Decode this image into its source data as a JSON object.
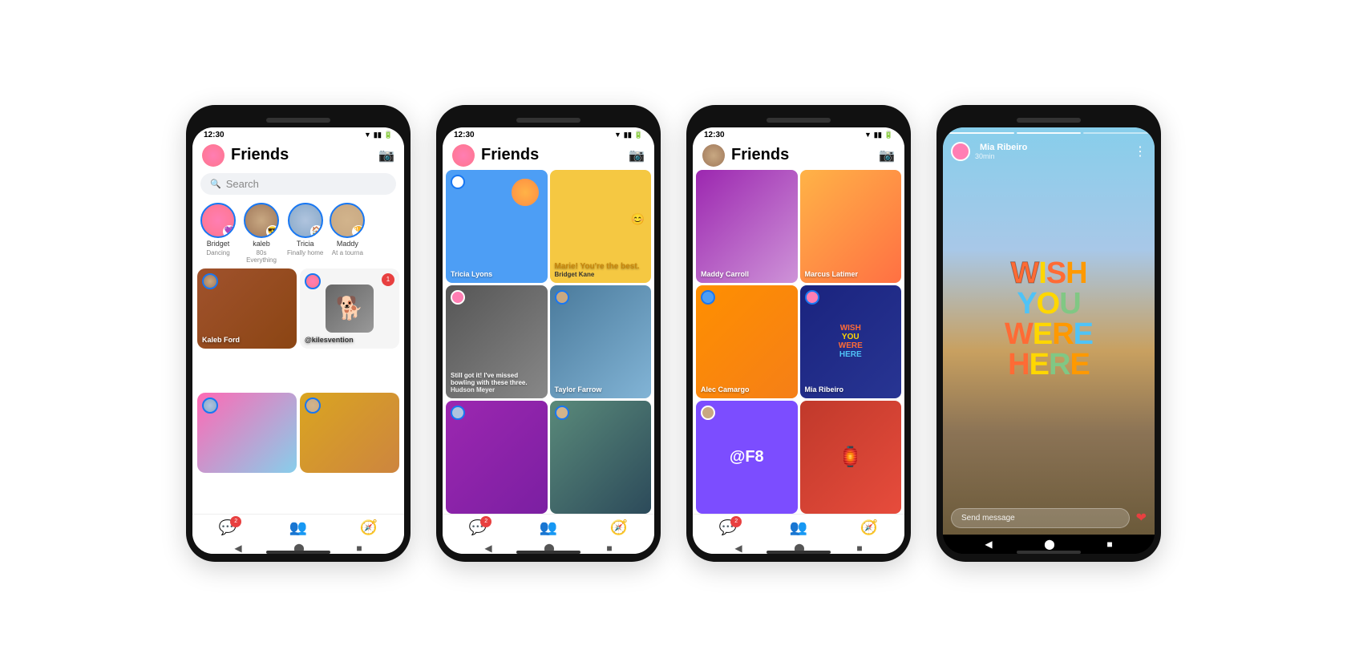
{
  "phones": [
    {
      "id": "phone1",
      "status_time": "12:30",
      "header_title": "Friends",
      "search_placeholder": "Search",
      "stories": [
        {
          "name": "Bridget",
          "sub": "Dancing",
          "av_class": "av1",
          "badge": "💜"
        },
        {
          "name": "kaleb",
          "sub": "80s Everything",
          "av_class": "av2",
          "badge": "😎"
        },
        {
          "name": "Tricia",
          "sub": "Finally home",
          "av_class": "av3",
          "badge": "🏠"
        },
        {
          "name": "Maddy",
          "sub": "At a tourna",
          "av_class": "av4",
          "badge": "🏆"
        }
      ],
      "cards": [
        {
          "label": "Kaleb Ford",
          "bg": "bg-friends",
          "has_av": true,
          "av_class": "av2"
        },
        {
          "label": "@kilesven​tion",
          "bg": "bg-dogs",
          "has_av": true,
          "av_class": "av1",
          "notif": "1"
        },
        {
          "label": "",
          "bg": "bg-pink",
          "has_av": true,
          "av_class": "av3"
        },
        {
          "label": "",
          "bg": "bg-warm",
          "has_av": true,
          "av_class": "av4"
        }
      ],
      "nav_badge": "2"
    },
    {
      "id": "phone2",
      "status_time": "12:30",
      "header_title": "Friends",
      "cards": [
        {
          "title": "Tricia Lyons",
          "sub": "",
          "bg": "bg-blue",
          "has_av": true
        },
        {
          "title": "Marie! You're the best.",
          "sub": "Bridget Kane",
          "bg": "bg-yellow",
          "text_dark": true
        },
        {
          "title": "Still got it! I've missed bowling with these three.",
          "sub": "Hudson Meyer",
          "bg": "bg-bowling"
        },
        {
          "title": "Taylor Farrow",
          "sub": "",
          "bg": "bg-dance",
          "has_av": true
        },
        {
          "title": "",
          "sub": "",
          "bg": "bg-hair",
          "has_av": true
        },
        {
          "title": "",
          "sub": "",
          "bg": "bg-teal-portrait",
          "has_av": true
        }
      ],
      "nav_badge": "2"
    },
    {
      "id": "phone3",
      "status_time": "12:30",
      "header_title": "Friends",
      "cards": [
        {
          "title": "Maddy Carroll",
          "sub": "",
          "bg": "bg-hair"
        },
        {
          "title": "Marcus Latimer",
          "sub": "",
          "bg": "bg-peach"
        },
        {
          "title": "Alec Camargo",
          "sub": "",
          "bg": "bg-autumn",
          "has_av": true
        },
        {
          "title": "Mia Ribeiro",
          "sub": "",
          "bg": "bg-wish-card"
        },
        {
          "title": "@F8",
          "sub": "",
          "bg": "bg-purple",
          "has_av": true
        },
        {
          "title": "",
          "sub": "",
          "bg": "bg-red-festive"
        }
      ],
      "nav_badge": "2"
    },
    {
      "id": "phone4",
      "user_name": "Mia Ribeiro",
      "user_time": "30min",
      "wish_lines": [
        "WISH",
        "YOU",
        "WERE",
        "HERE"
      ],
      "send_placeholder": "Send message"
    }
  ],
  "icons": {
    "camera": "📷",
    "search": "🔍",
    "back": "◀",
    "home": "⬤",
    "square": "■",
    "chat": "💬",
    "friends": "👥",
    "compass": "🧭",
    "heart": "❤"
  }
}
